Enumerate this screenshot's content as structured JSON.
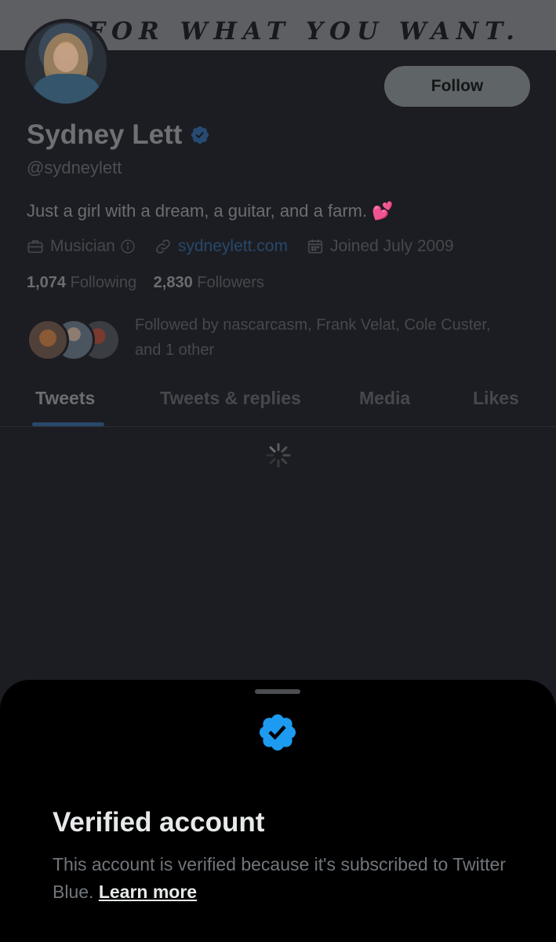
{
  "banner": {
    "text": "FOR WHAT YOU WANT."
  },
  "profile": {
    "name": "Sydney Lett",
    "handle": "@sydneylett",
    "bio": "Just a girl with a dream, a guitar, and a farm.",
    "bio_emoji": "💕",
    "category": "Musician",
    "website": "sydneylett.com",
    "joined": "Joined July 2009",
    "following_count": "1,074",
    "following_label": "Following",
    "followers_count": "2,830",
    "followers_label": "Followers",
    "followed_by": "Followed by nascarcasm, Frank Velat, Cole Custer, and 1 other"
  },
  "follow_button": {
    "label": "Follow"
  },
  "tabs": [
    {
      "label": "Tweets",
      "active": true
    },
    {
      "label": "Tweets & replies",
      "active": false
    },
    {
      "label": "Media",
      "active": false
    },
    {
      "label": "Likes",
      "active": false
    }
  ],
  "sheet": {
    "title": "Verified account",
    "body": "This account is verified because it's subscribed to Twitter Blue.",
    "link": "Learn more"
  },
  "colors": {
    "verified_blue": "#1d9bf0",
    "link_dim": "#27486a",
    "sheet_bg": "#000000",
    "page_bg": "#1c1d22"
  },
  "icons": [
    "verified-badge-icon",
    "briefcase-icon",
    "info-icon",
    "link-icon",
    "calendar-icon",
    "loading-spinner-icon"
  ]
}
